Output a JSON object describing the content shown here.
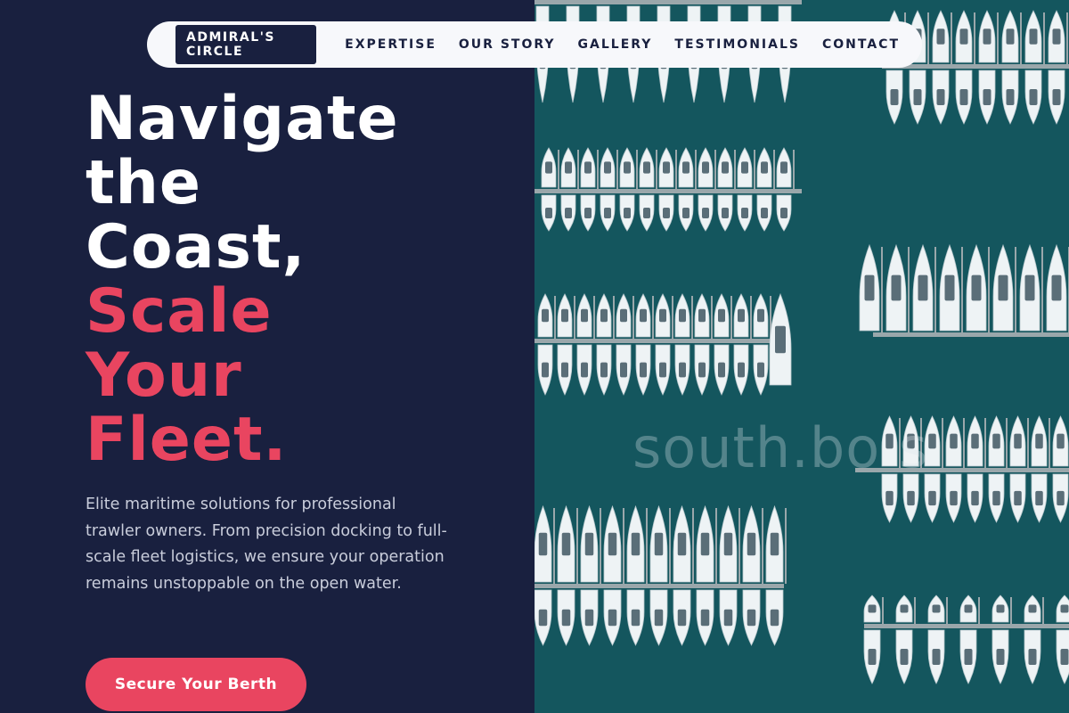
{
  "nav": {
    "logo": "ADMIRAL'S CIRCLE",
    "links": [
      "EXPERTISE",
      "OUR STORY",
      "GALLERY",
      "TESTIMONIALS",
      "CONTACT"
    ]
  },
  "hero": {
    "title_white": [
      "Navigate",
      "the",
      "Coast,"
    ],
    "title_pink": [
      "Scale",
      "Your",
      "Fleet."
    ],
    "description": "Elite maritime solutions for professional trawler owners. From precision docking to full-scale fleet logistics, we ensure your operation remains unstoppable on the open water.",
    "cta_label": "Secure Your Berth"
  },
  "image": {
    "watermark": "south.bo s"
  },
  "colors": {
    "navy": "#19203f",
    "accent": "#e94560",
    "water": "#14565e",
    "nav_bg": "#f7f8fb"
  }
}
